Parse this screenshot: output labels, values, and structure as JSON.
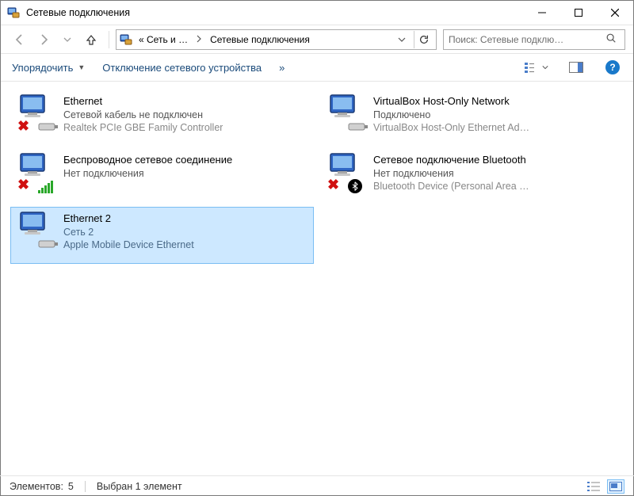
{
  "window": {
    "title": "Сетевые подключения"
  },
  "breadcrumb": {
    "root_label": "«  Сеть и …",
    "current": "Сетевые подключения"
  },
  "search": {
    "placeholder": "Поиск: Сетевые подклю…"
  },
  "toolbar": {
    "organize": "Упорядочить",
    "disable": "Отключение сетевого устройства",
    "overflow": "»"
  },
  "connections": [
    {
      "name": "Ethernet",
      "status": "Сетевой кабель не подключен",
      "device": "Realtek PCIe GBE Family Controller",
      "overlay": "redx-adapter",
      "selected": false
    },
    {
      "name": "VirtualBox Host-Only Network",
      "status": "Подключено",
      "device": "VirtualBox Host-Only Ethernet Ad…",
      "overlay": "adapter",
      "selected": false
    },
    {
      "name": "Беспроводное сетевое соединение",
      "status": "Нет подключения",
      "device": "",
      "overlay": "redx-wifi",
      "selected": false
    },
    {
      "name": "Сетевое подключение Bluetooth",
      "status": "Нет подключения",
      "device": "Bluetooth Device (Personal Area …",
      "overlay": "redx-bt",
      "selected": false
    },
    {
      "name": "Ethernet 2",
      "status": "Сеть 2",
      "device": "Apple Mobile Device Ethernet",
      "overlay": "adapter",
      "selected": true
    }
  ],
  "statusbar": {
    "items_label": "Элементов:",
    "items_count": "5",
    "selected_label": "Выбран 1 элемент"
  }
}
